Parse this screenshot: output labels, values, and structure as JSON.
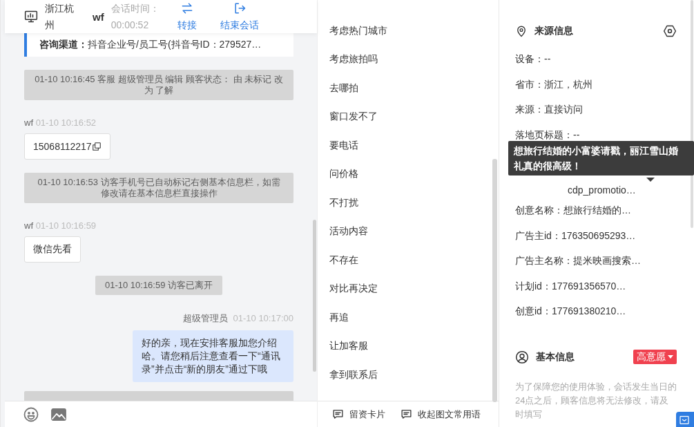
{
  "header": {
    "location": "浙江杭州",
    "visitor": "wf",
    "session_label": "会话时间：",
    "session_time": "00:00:52",
    "actions": [
      {
        "kind": "transfer",
        "label": "转接"
      },
      {
        "kind": "end",
        "label": "结束会话"
      }
    ]
  },
  "channel": {
    "label": "咨询渠道：",
    "value": "抖音企业号/员工号(抖音号ID：279527…"
  },
  "messages": [
    {
      "kind": "system",
      "text": "01-10 10:16:45 客服 超级管理员 编辑 顾客状态： 由 未标记 改为 了解"
    },
    {
      "kind": "visitor",
      "sender": "wf",
      "time": "01-10 10:16:52",
      "text": "15068112217",
      "copy": true
    },
    {
      "kind": "system",
      "text": "01-10 10:16:53 访客手机号已自动标记右侧基本信息栏，如需修改请在基本信息栏直接操作"
    },
    {
      "kind": "visitor",
      "sender": "wf",
      "time": "01-10 10:16:59",
      "text": "微信先看",
      "copy": false
    },
    {
      "kind": "system",
      "text": "01-10 10:16:59 访客已离开"
    },
    {
      "kind": "agent",
      "sender": "超级管理员",
      "time": "01-10 10:17:00",
      "text": "好的亲，现在安排客服加您介绍哈。请您稍后注意查看一下“通讯录”并点击“新的朋友”通过下哦"
    }
  ],
  "phrases": [
    {
      "text": "考虑热门城市"
    },
    {
      "text": "考虑旅拍吗"
    },
    {
      "text": "去哪拍"
    },
    {
      "text": "窗口发不了"
    },
    {
      "text": "要电话"
    },
    {
      "text": "问价格"
    },
    {
      "text": "不打扰"
    },
    {
      "text": "活动内容"
    },
    {
      "text": "不存在"
    },
    {
      "text": "对比再决定"
    },
    {
      "text": "再追"
    },
    {
      "text": "让加客服"
    },
    {
      "text": "拿到联系后"
    }
  ],
  "phrase_footer": [
    {
      "label": "留资卡片"
    },
    {
      "label": "收起图文常用语"
    }
  ],
  "source": {
    "title": "来源信息",
    "rows_before": [
      "设备：--",
      "省市：浙江，杭州",
      "来源：直接访问",
      "落地页标题：--"
    ],
    "covered_value": "cdp_promotio…",
    "tooltip": "想旅行结婚的小富婆请戳，丽江雪山婚礼真的很高级！",
    "rows_after": [
      "创意名称：想旅行结婚的…",
      "广告主id：176350695293…",
      "广告主名称：提米映画搜索…",
      "计划id：177691356570…",
      "创意id：177691380210…"
    ]
  },
  "basic": {
    "title": "基本信息",
    "intent": "高意愿",
    "note": "为了保障您的使用体验，会话发生当日的24点之后，顾客信息将无法修改，请及时填写"
  }
}
